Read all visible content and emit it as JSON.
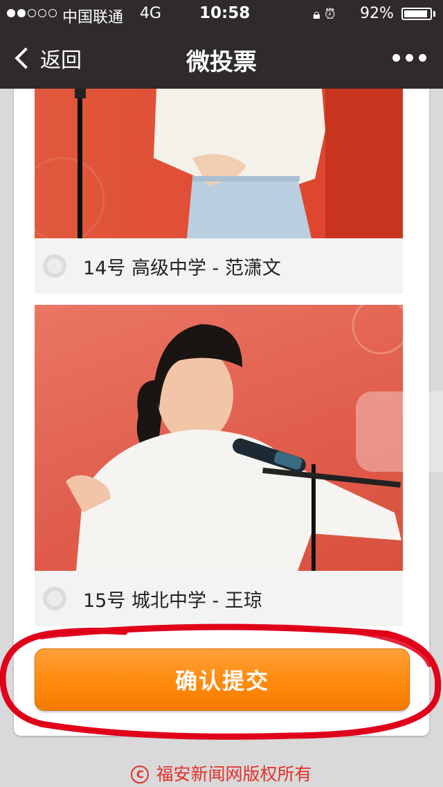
{
  "status_bar": {
    "carrier": "中国联通",
    "network": "4G",
    "time": "10:58",
    "battery": "92%",
    "battery_level": 0.92
  },
  "nav": {
    "back_label": "返回",
    "title": "微投票"
  },
  "candidates": [
    {
      "number": "14号",
      "school": "高级中学",
      "name": "范潇文",
      "label": "14号 高级中学 - 范潇文",
      "selected": false
    },
    {
      "number": "15号",
      "school": "城北中学",
      "name": "王琼",
      "label": "15号 城北中学 - 王琼",
      "selected": false
    }
  ],
  "submit_label": "确认提交",
  "footer": {
    "copyright_symbol": "C",
    "text": "福安新闻网版权所有"
  },
  "colors": {
    "nav_bg": "#2e2b2a",
    "accent": "#ff8a0c",
    "footer_text": "#e2312a",
    "annotation": "#e0001a"
  }
}
